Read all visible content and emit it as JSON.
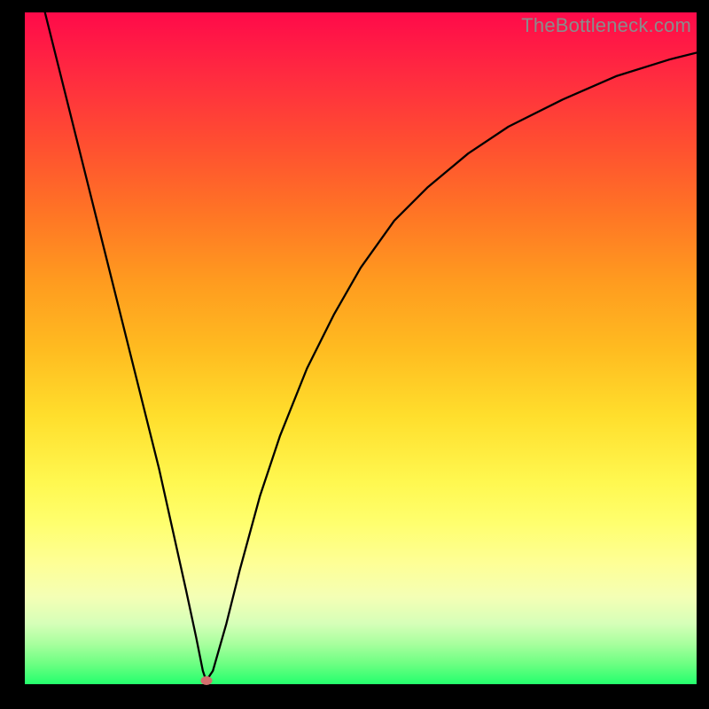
{
  "watermark": "TheBottleneck.com",
  "chart_data": {
    "type": "line",
    "title": "",
    "xlabel": "",
    "ylabel": "",
    "xlim": [
      0,
      100
    ],
    "ylim": [
      0,
      100
    ],
    "grid": false,
    "legend": false,
    "series": [
      {
        "name": "curve",
        "x": [
          3,
          5,
          8,
          11,
          14,
          17,
          20,
          22,
          24,
          25.5,
          26.5,
          27,
          28,
          30,
          32,
          35,
          38,
          42,
          46,
          50,
          55,
          60,
          66,
          72,
          80,
          88,
          96,
          100
        ],
        "y": [
          100,
          92,
          80,
          68,
          56,
          44,
          32,
          23,
          14,
          7,
          2,
          0.5,
          2,
          9,
          17,
          28,
          37,
          47,
          55,
          62,
          69,
          74,
          79,
          83,
          87,
          90.5,
          93,
          94
        ]
      }
    ],
    "marker": {
      "x": 27,
      "y": 0.5
    },
    "background_gradient_stops": [
      {
        "pct": 0,
        "color": "#ff0a4a"
      },
      {
        "pct": 50,
        "color": "#ffbb20"
      },
      {
        "pct": 76,
        "color": "#ffff6e"
      },
      {
        "pct": 100,
        "color": "#24ff6d"
      }
    ]
  }
}
